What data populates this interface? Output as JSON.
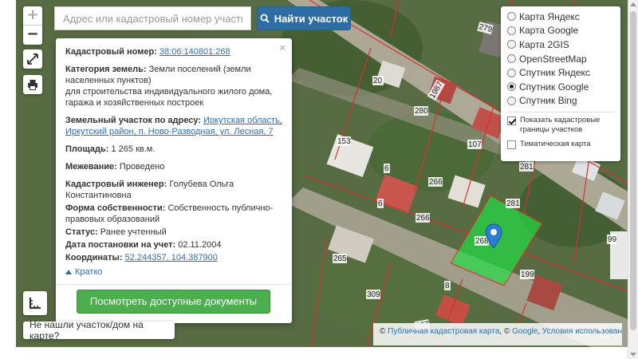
{
  "search": {
    "placeholder": "Адрес или кадастровый номер участка",
    "button_label": "Найти участок",
    "button_icon": "search-icon"
  },
  "zoom": {
    "in_label": "+",
    "out_label": "−"
  },
  "info_panel": {
    "close_label": "×",
    "cadastral_number_label": "Кадастровый номер:",
    "cadastral_number_value": "38:06:140801:268",
    "land_category_label": "Категория земель:",
    "land_category_value": "Земли поселений (земли населенных пунктов)",
    "land_use": "для строительства индивидуального жилого дома, гаража и хозяйственных построек",
    "address_label": "Земельный участок по адресу:",
    "address_value": "Иркутская область, Иркутский район, п. Ново-Разводная, ул. Лесная, 7",
    "area_label": "Площадь:",
    "area_value": "1 265 кв.м.",
    "survey_label": "Межевание:",
    "survey_value": "Проведено",
    "engineer_label": "Кадастровый инженер:",
    "engineer_value": "Голубева Ольга Константиновна",
    "ownership_label": "Форма собственности:",
    "ownership_value": "Собственность публично-правовых образований",
    "status_label": "Статус:",
    "status_value": "Ранее учтенный",
    "registration_date_label": "Дата постановки на учет:",
    "registration_date_value": "02.11.2004",
    "coordinates_label": "Координаты:",
    "coordinates_value": "52.244357, 104.387900",
    "collapse_label": "Кратко",
    "docs_button_label": "Посмотреть доступные документы"
  },
  "layers": {
    "options": [
      {
        "label": "Карта Яндекс",
        "selected": false
      },
      {
        "label": "Карта Google",
        "selected": false
      },
      {
        "label": "Карта 2GIS",
        "selected": false
      },
      {
        "label": "OpenStreetMap",
        "selected": false
      },
      {
        "label": "Спутник Яндекс",
        "selected": false
      },
      {
        "label": "Спутник Google",
        "selected": true
      },
      {
        "label": "Спутник Bing",
        "selected": false
      }
    ],
    "show_boundaries_label": "Показать кадастровые границы участков",
    "show_boundaries_checked": true,
    "thematic_label": "Тематическая карта",
    "thematic_checked": false
  },
  "map_labels": [
    "279",
    "20",
    "1987",
    "280",
    "153",
    "107",
    "281",
    "6",
    "266",
    "6",
    "281",
    "266",
    "268",
    "265",
    "99",
    "199",
    "309",
    "8",
    "10",
    "267"
  ],
  "not_found_label": "Не нашли участок/дом на карте?",
  "attribution": {
    "prefix": "©",
    "pkk_link": "Публичная кадастровая карта",
    "sep": ", ©",
    "google_link": "Google",
    "terms_link": "Условия использования"
  },
  "colors": {
    "selected_parcel": "#22dd44",
    "boundary": "#d83030",
    "search_button": "#2e6da4",
    "docs_button": "#4cae4c",
    "marker": "#2b7cd3"
  }
}
